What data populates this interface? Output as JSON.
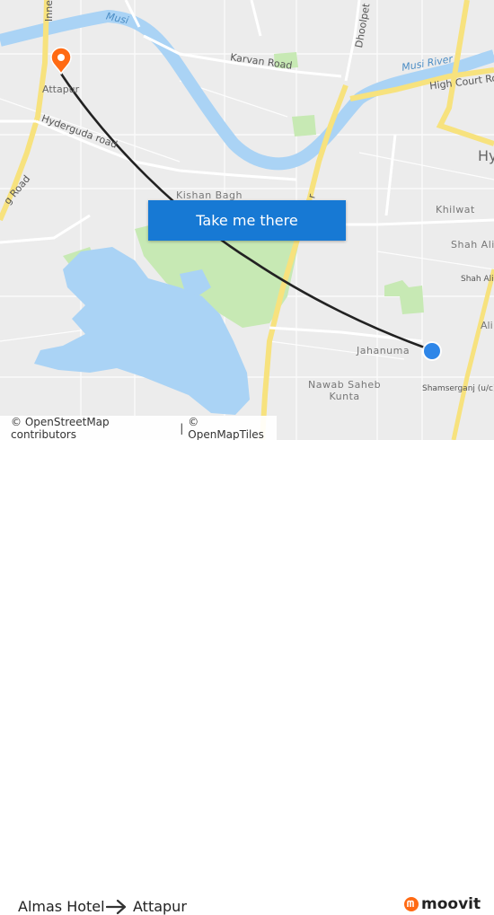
{
  "map": {
    "labels": {
      "inner": "Inner",
      "musi": "Musi",
      "musi_river": "Musi River",
      "karvan_road": "Karvan Road",
      "dhoolpet": "Dhoolpet",
      "high_court_road": "High Court Road",
      "attapur": "Attapur",
      "hyderguda_road": "Hyderguda road",
      "g_road": "g Road",
      "kishan_bagh": "Kishan Bagh",
      "khilwat": "Khilwat",
      "hy": "Hy",
      "shah_ali": "Shah Ali",
      "shah_ali_b": "Shah Ali B",
      "ali": "Ali",
      "jahanuma": "Jahanuma",
      "nawab_saheb_kunta": "Nawab Saheb\nKunta",
      "shamserganj": "Shamserganj (u/c)",
      "r": "r"
    },
    "colors": {
      "background": "#ececec",
      "water": "#aad3f5",
      "park": "#c7e9b4",
      "major_road": "#f7e27e",
      "route_line": "#222222",
      "origin_marker": "#2e86e8",
      "destination_marker": "#ff6a13"
    },
    "markers": {
      "origin_icon": "blue-location-dot-icon",
      "destination_icon": "orange-pin-icon"
    }
  },
  "cta": {
    "label": "Take me there"
  },
  "attribution": {
    "osm": "© OpenStreetMap contributors",
    "separator": "|",
    "omt": "© OpenMapTiles"
  },
  "route": {
    "from": "Almas Hotel",
    "to": "Attapur",
    "arrow_icon": "arrow-right-icon"
  },
  "brand": {
    "name": "moovit",
    "logo_icon": "moovit-logo-icon"
  }
}
